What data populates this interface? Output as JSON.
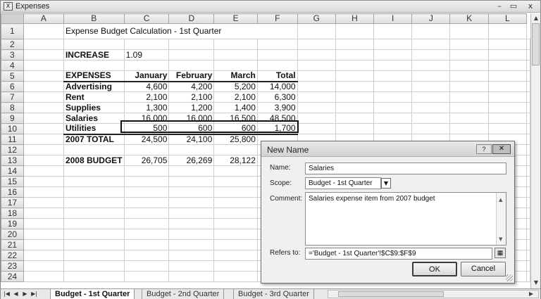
{
  "window": {
    "title": "Expenses",
    "app_icon": "excel-icon"
  },
  "columns": [
    "A",
    "B",
    "C",
    "D",
    "E",
    "F",
    "G",
    "H",
    "I",
    "J",
    "K",
    "L"
  ],
  "rows": [
    {
      "n": "1",
      "title": "Expense Budget Calculation - 1st Quarter"
    },
    {
      "n": "2"
    },
    {
      "n": "3",
      "label": "INCREASE",
      "c": "1.09"
    },
    {
      "n": "4"
    },
    {
      "n": "5",
      "label": "EXPENSES",
      "c": "January",
      "d": "February",
      "e": "March",
      "f": "Total"
    },
    {
      "n": "6",
      "label": "Advertising",
      "c": "4,600",
      "d": "4,200",
      "e": "5,200",
      "f": "14,000"
    },
    {
      "n": "7",
      "label": "Rent",
      "c": "2,100",
      "d": "2,100",
      "e": "2,100",
      "f": "6,300"
    },
    {
      "n": "8",
      "label": "Supplies",
      "c": "1,300",
      "d": "1,200",
      "e": "1,400",
      "f": "3,900"
    },
    {
      "n": "9",
      "label": "Salaries",
      "c": "16,000",
      "d": "16,000",
      "e": "16,500",
      "f": "48,500"
    },
    {
      "n": "10",
      "label": "Utilities",
      "c": "500",
      "d": "600",
      "e": "600",
      "f": "1,700"
    },
    {
      "n": "11",
      "label": "2007 TOTAL",
      "c": "24,500",
      "d": "24,100",
      "e": "25,800"
    },
    {
      "n": "12"
    },
    {
      "n": "13",
      "label": "2008 BUDGET",
      "c": "26,705",
      "d": "26,269",
      "e": "28,122"
    },
    {
      "n": "14"
    },
    {
      "n": "15"
    },
    {
      "n": "16"
    },
    {
      "n": "17"
    },
    {
      "n": "18"
    },
    {
      "n": "19"
    },
    {
      "n": "20"
    },
    {
      "n": "21"
    },
    {
      "n": "22"
    },
    {
      "n": "23"
    },
    {
      "n": "24"
    }
  ],
  "sheet_tabs": [
    "Budget - 1st Quarter",
    "Budget - 2nd Quarter",
    "Budget - 3rd Quarter"
  ],
  "active_tab": "Budget - 1st Quarter",
  "dialog": {
    "title": "New Name",
    "help": "?",
    "close": "✕",
    "name_label": "Name:",
    "name_value": "Salaries",
    "scope_label": "Scope:",
    "scope_value": "Budget - 1st Quarter",
    "comment_label": "Comment:",
    "comment_value": "Salaries expense item from 2007 budget",
    "refers_label": "Refers to:",
    "refers_value": "='Budget - 1st Quarter'!$C$9:$F$9",
    "ok_label": "OK",
    "cancel_label": "Cancel"
  }
}
